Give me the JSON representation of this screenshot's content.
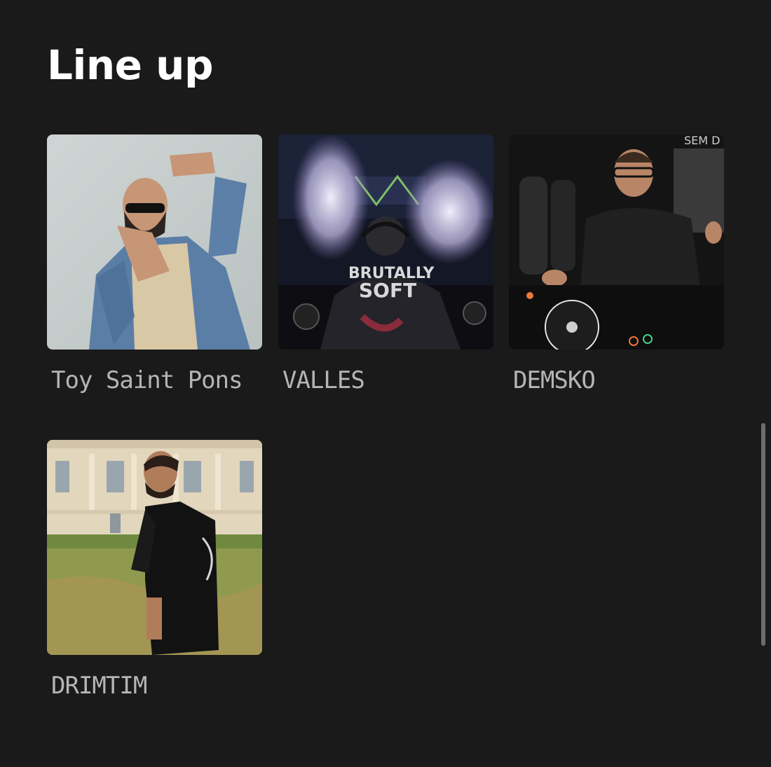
{
  "section": {
    "title": "Line up"
  },
  "artists": [
    {
      "name": "Toy Saint Pons"
    },
    {
      "name": "VALLES"
    },
    {
      "name": "DEMSKO"
    },
    {
      "name": "DRIMTIM"
    }
  ],
  "photo_text": {
    "shirt_line1": "BRUTALLY",
    "shirt_line2": "SOFT",
    "wall_sign": "SEM D"
  },
  "colors": {
    "background": "#1a1a1a",
    "title": "#ffffff",
    "artist_name": "#b5b5b5",
    "scrollbar": "#6d6d6d"
  }
}
